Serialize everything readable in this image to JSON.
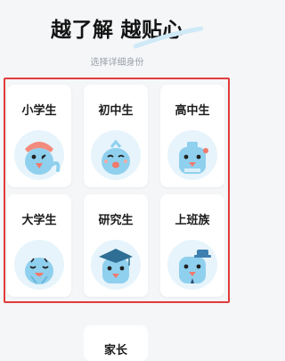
{
  "header": {
    "title_part1": "越了解",
    "title_part2": "越贴心",
    "subtitle": "选择详细身份"
  },
  "identities": [
    {
      "label": "小学生",
      "avatar": "bird-elementary-icon"
    },
    {
      "label": "初中生",
      "avatar": "bird-middle-school-icon"
    },
    {
      "label": "高中生",
      "avatar": "bird-high-school-icon"
    },
    {
      "label": "大学生",
      "avatar": "bird-college-icon"
    },
    {
      "label": "研究生",
      "avatar": "bird-graduate-icon"
    },
    {
      "label": "上班族",
      "avatar": "bird-office-worker-icon"
    }
  ],
  "parent": {
    "label": "家长"
  },
  "colors": {
    "bird_body": "#8fd0ee",
    "avatar_bg": "#e7f4fb",
    "beak": "#f0796b",
    "highlight_frame": "#e23b3b"
  }
}
